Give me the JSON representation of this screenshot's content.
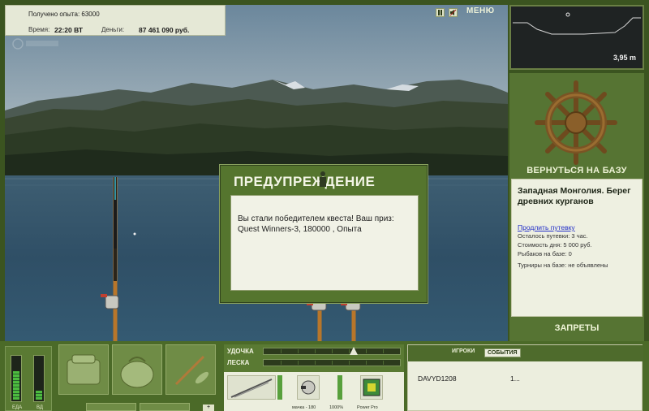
{
  "info": {
    "experience_text": "Получено опыта: 63000",
    "time_label": "Время:",
    "time_value": "22:20 ВТ",
    "money_label": "Деньги:",
    "money_value": "87 461 090 руб."
  },
  "topbar": {
    "menu_label": "МЕНЮ",
    "pause_icon": "pause-icon",
    "sound_icon": "sound-icon"
  },
  "minimap": {
    "depth": "3,95 m"
  },
  "right_panel": {
    "return_label": "ВЕРНУТЬСЯ НА БАЗУ",
    "location_region": "Западная Монголия. Берег древних курганов",
    "extend_link": "Продлить путевку",
    "stats": [
      "Осталось путевки: 3 час.",
      "Стоимость дня: 5 000 руб.",
      "Рыбаков на базе: 0",
      "Турниры на базе: не объявлены"
    ],
    "bans_label": "ЗАПРЕТЫ"
  },
  "modal": {
    "title": "ПРЕДУПРЕЖДЕНИЕ",
    "message": "Вы стали победителем квеста! Ваш приз: Quest Winners-3, 180000 , Опыта"
  },
  "bottom": {
    "meter_labels": [
      "ЕДА",
      "ВД"
    ],
    "meter_levels": [
      0.62,
      0.2
    ],
    "gear_rod_label": "УДОЧКА",
    "gear_line_label": "ЛЕСКА",
    "gear_item_captions": [
      "мачка - 180",
      "1000%",
      "Power Pro"
    ],
    "players_tab": "ИГРОКИ",
    "events_tab": "СОБЫТИЯ",
    "player_name": "DAVYD1208",
    "player_extra": "1..."
  },
  "colors": {
    "ui_green": "#567433",
    "panel_light": "#eceede",
    "link_blue": "#2430c8"
  }
}
